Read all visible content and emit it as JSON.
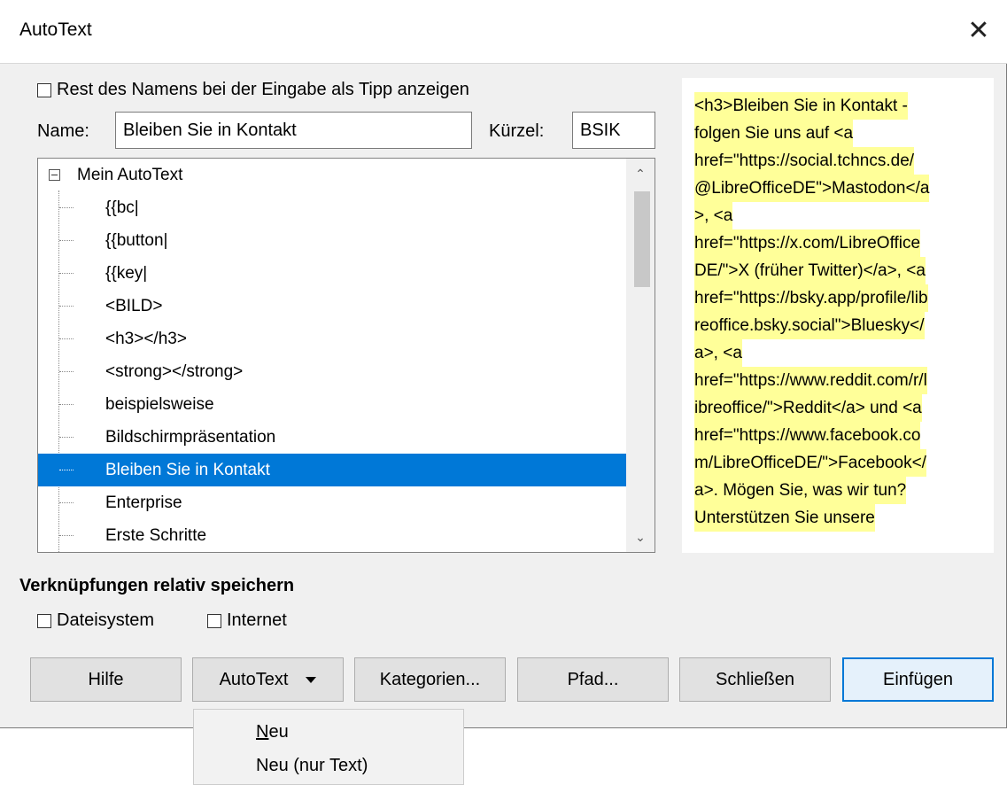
{
  "window": {
    "title": "AutoText",
    "close_label": "✕"
  },
  "options": {
    "show_tip_label": "Rest des Namens bei der Eingabe als Tipp anzeigen",
    "show_tip_checked": false
  },
  "name_field": {
    "label": "Name:",
    "value": "Bleiben Sie in Kontakt"
  },
  "shortcut_field": {
    "label": "Kürzel:",
    "value": "BSIK"
  },
  "tree": {
    "root_label": "Mein AutoText",
    "items": [
      {
        "label": "{{bc|"
      },
      {
        "label": "{{button|"
      },
      {
        "label": "{{key|"
      },
      {
        "label": "<BILD>"
      },
      {
        "label": "<h3></h3>"
      },
      {
        "label": "<strong></strong>"
      },
      {
        "label": "beispielsweise"
      },
      {
        "label": "Bildschirmpräsentation"
      },
      {
        "label": "Bleiben Sie in Kontakt"
      },
      {
        "label": "Enterprise"
      },
      {
        "label": "Erste Schritte"
      }
    ],
    "selected_index": 8,
    "scroll_up": "⌃",
    "scroll_down": "⌄"
  },
  "preview": {
    "lines": [
      "<h3>Bleiben Sie in Kontakt -",
      "folgen Sie uns auf <a",
      "href=\"https://social.tchncs.de/",
      "@LibreOfficeDE\">Mastodon</a",
      ">, <a",
      "href=\"https://x.com/LibreOffice",
      "DE/\">X (früher Twitter)</a>, <a",
      "href=\"https://bsky.app/profile/lib",
      "reoffice.bsky.social\">Bluesky</",
      "a>, <a",
      "href=\"https://www.reddit.com/r/l",
      "ibreoffice/\">Reddit</a> und <a",
      "href=\"https://www.facebook.co",
      "m/LibreOfficeDE/\">Facebook</",
      "a>. Mögen Sie, was wir tun?",
      "Unterstützen Sie unsere"
    ],
    "highlight_color": "#ffff99"
  },
  "links": {
    "section_title": "Verknüpfungen relativ speichern",
    "filesystem_label": "Dateisystem",
    "internet_label": "Internet"
  },
  "buttons": {
    "help": "Hilfe",
    "autotext": "AutoText",
    "categories": "Kategorien...",
    "path": "Pfad...",
    "close": "Schließen",
    "insert": "Einfügen"
  },
  "menu": {
    "items": [
      {
        "label": "Neu",
        "mnemonic": "N"
      },
      {
        "label": "Neu (nur Text)"
      }
    ]
  },
  "colors": {
    "selection": "#0078d7",
    "dialog_bg": "#f0f0f0"
  }
}
